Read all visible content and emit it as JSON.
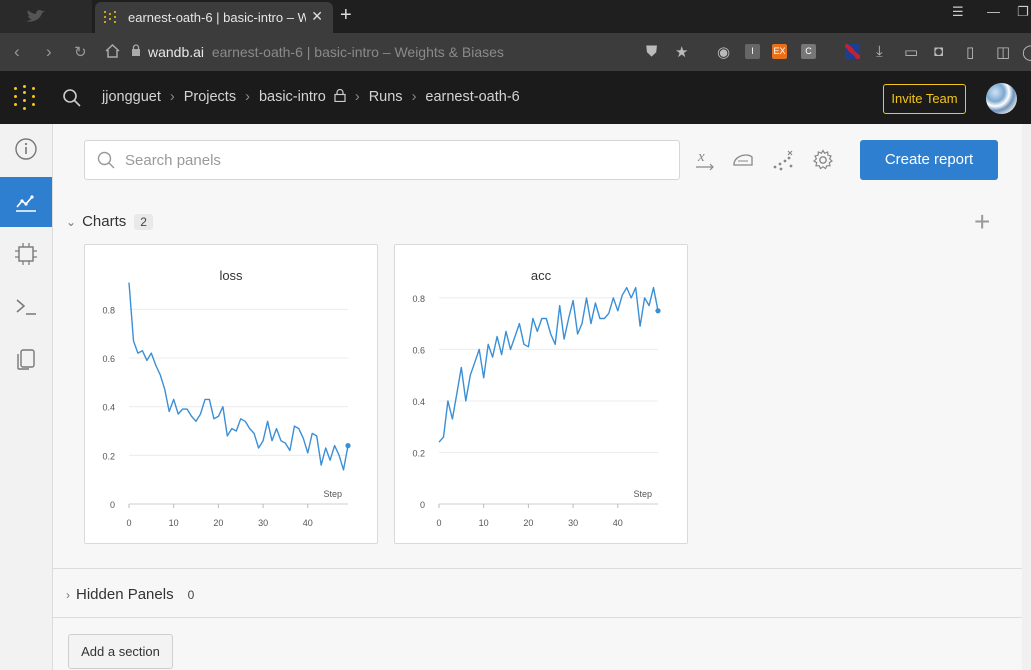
{
  "browser": {
    "tab_title": "earnest-oath-6 | basic-intro – W",
    "new_tab": "+",
    "url_host": "wandb.ai",
    "url_rest": "earnest-oath-6 | basic-intro – Weights & Biases",
    "ext_labels": [
      "I",
      "EX",
      "C"
    ]
  },
  "header": {
    "crumbs": [
      "jjongguet",
      "Projects",
      "basic-intro",
      "Runs",
      "earnest-oath-6"
    ],
    "separator": "›",
    "invite_label": "Invite Team"
  },
  "sidebar": {
    "items": [
      {
        "icon": "info-icon",
        "active": false
      },
      {
        "icon": "chart-icon",
        "active": true
      },
      {
        "icon": "chip-icon",
        "active": false
      },
      {
        "icon": "terminal-icon",
        "active": false
      },
      {
        "icon": "files-icon",
        "active": false
      }
    ]
  },
  "toolbar": {
    "search_placeholder": "Search panels",
    "create_report_label": "Create report"
  },
  "sections": {
    "charts_label": "Charts",
    "charts_count": "2",
    "hidden_label": "Hidden Panels",
    "hidden_count": "0",
    "add_section_label": "Add a section"
  },
  "chart_data": [
    {
      "type": "line",
      "title": "loss",
      "xlabel": "Step",
      "ylabel": "",
      "xlim": [
        0,
        49
      ],
      "ylim": [
        0,
        0.9
      ],
      "xticks": [
        0,
        10,
        20,
        30,
        40
      ],
      "yticks": [
        0,
        0.2,
        0.4,
        0.6,
        0.8
      ],
      "ytick_labels": [
        "0",
        "0.2",
        "0.4",
        "0.6",
        "0.8"
      ],
      "color": "#3a8fd6",
      "x": [
        0,
        1,
        2,
        3,
        4,
        5,
        6,
        7,
        8,
        9,
        10,
        11,
        12,
        13,
        14,
        15,
        16,
        17,
        18,
        19,
        20,
        21,
        22,
        23,
        24,
        25,
        26,
        27,
        28,
        29,
        30,
        31,
        32,
        33,
        34,
        35,
        36,
        37,
        38,
        39,
        40,
        41,
        42,
        43,
        44,
        45,
        46,
        47,
        48,
        49
      ],
      "y": [
        0.91,
        0.67,
        0.62,
        0.63,
        0.59,
        0.62,
        0.57,
        0.53,
        0.47,
        0.38,
        0.43,
        0.37,
        0.39,
        0.39,
        0.36,
        0.34,
        0.37,
        0.43,
        0.43,
        0.35,
        0.36,
        0.4,
        0.28,
        0.31,
        0.3,
        0.35,
        0.34,
        0.31,
        0.29,
        0.23,
        0.26,
        0.34,
        0.26,
        0.31,
        0.26,
        0.25,
        0.22,
        0.32,
        0.31,
        0.27,
        0.21,
        0.29,
        0.28,
        0.16,
        0.23,
        0.18,
        0.24,
        0.2,
        0.14,
        0.24
      ]
    },
    {
      "type": "line",
      "title": "acc",
      "xlabel": "Step",
      "ylabel": "",
      "xlim": [
        0,
        49
      ],
      "ylim": [
        0,
        0.85
      ],
      "xticks": [
        0,
        10,
        20,
        30,
        40
      ],
      "yticks": [
        0,
        0.2,
        0.4,
        0.6,
        0.8
      ],
      "ytick_labels": [
        "0",
        "0.2",
        "0.4",
        "0.6",
        "0.8"
      ],
      "color": "#3a8fd6",
      "x": [
        0,
        1,
        2,
        3,
        4,
        5,
        6,
        7,
        8,
        9,
        10,
        11,
        12,
        13,
        14,
        15,
        16,
        17,
        18,
        19,
        20,
        21,
        22,
        23,
        24,
        25,
        26,
        27,
        28,
        29,
        30,
        31,
        32,
        33,
        34,
        35,
        36,
        37,
        38,
        39,
        40,
        41,
        42,
        43,
        44,
        45,
        46,
        47,
        48,
        49
      ],
      "y": [
        0.24,
        0.26,
        0.4,
        0.33,
        0.43,
        0.53,
        0.4,
        0.5,
        0.55,
        0.6,
        0.49,
        0.62,
        0.57,
        0.65,
        0.58,
        0.67,
        0.6,
        0.65,
        0.7,
        0.62,
        0.61,
        0.72,
        0.67,
        0.72,
        0.72,
        0.66,
        0.62,
        0.77,
        0.64,
        0.72,
        0.79,
        0.66,
        0.7,
        0.8,
        0.7,
        0.78,
        0.72,
        0.72,
        0.74,
        0.8,
        0.75,
        0.81,
        0.84,
        0.8,
        0.84,
        0.69,
        0.8,
        0.77,
        0.84,
        0.75
      ]
    }
  ]
}
